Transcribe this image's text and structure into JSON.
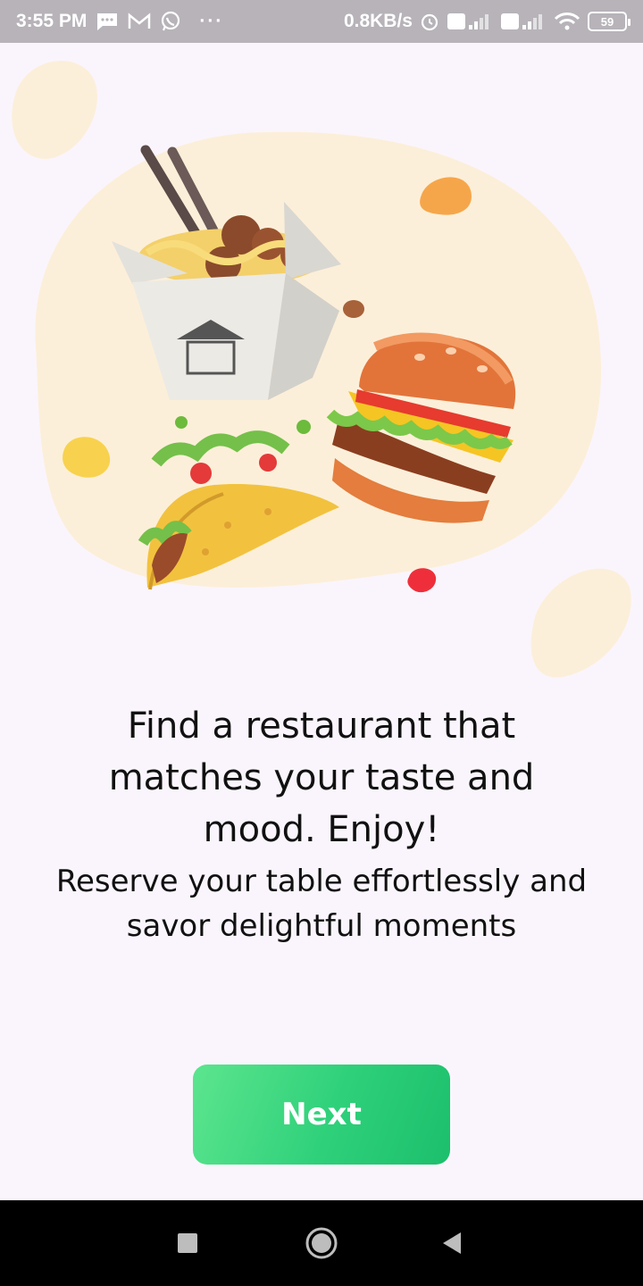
{
  "status_bar": {
    "time": "3:55 PM",
    "more": "···",
    "net_speed": "0.8KB/s",
    "battery": "59",
    "icons": [
      "message-icon",
      "gmail-icon",
      "whatsapp-icon",
      "alarm-icon",
      "volte-icon",
      "signal-icon",
      "wifi-icon",
      "battery-icon"
    ]
  },
  "onboarding": {
    "headline": "Find a restaurant that matches your taste and mood. Enjoy!",
    "subtext": "Reserve your table effortlessly and savor delightful moments",
    "next_label": "Next"
  },
  "navigation": {
    "icons": [
      "recents-icon",
      "home-icon",
      "back-icon"
    ]
  },
  "colors": {
    "background": "#faf5fc",
    "status_bar": "#b7b3b9",
    "blob": "#fdf0da",
    "accent_green": "#2ed07a"
  }
}
